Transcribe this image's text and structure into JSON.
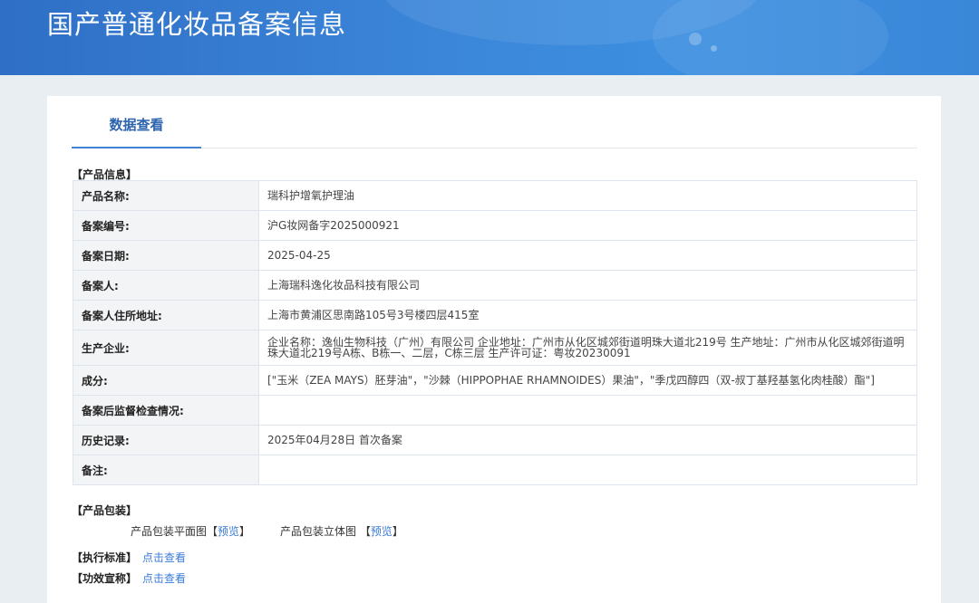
{
  "banner": {
    "title": "国产普通化妆品备案信息"
  },
  "tabs": [
    {
      "label": "数据查看"
    }
  ],
  "product_info": {
    "section_title": "【产品信息】",
    "rows": [
      {
        "label": "产品名称:",
        "value": "瑞科护增氧护理油"
      },
      {
        "label": "备案编号:",
        "value": "沪G妆网备字2025000921"
      },
      {
        "label": "备案日期:",
        "value": "2025-04-25"
      },
      {
        "label": "备案人:",
        "value": "上海瑞科逸化妆品科技有限公司"
      },
      {
        "label": "备案人住所地址:",
        "value": "上海市黄浦区思南路105号3号楼四层415室"
      },
      {
        "label": "生产企业:",
        "value": "企业名称：逸仙生物科技（广州）有限公司 企业地址：广州市从化区城郊街道明珠大道北219号 生产地址：广州市从化区城郊街道明珠大道北219号A栋、B栋一、二层，C栋三层 生产许可证：粤妆20230091"
      },
      {
        "label": "成分:",
        "value": "[\"玉米（ZEA MAYS）胚芽油\"，\"沙棘（HIPPOPHAE RHAMNOIDES）果油\"，\"季戊四醇四（双-叔丁基羟基氢化肉桂酸）酯\"]"
      },
      {
        "label": "备案后监督检查情况:",
        "value": ""
      },
      {
        "label": "历史记录:",
        "value": "2025年04月28日 首次备案"
      },
      {
        "label": "备注:",
        "value": ""
      }
    ]
  },
  "packaging": {
    "section_title": "【产品包装】",
    "flat_label": "产品包装平面图【",
    "flat_link": "预览",
    "flat_close": "】",
    "solid_label": "产品包装立体图 【",
    "solid_link": "预览",
    "solid_close": "】"
  },
  "standard": {
    "label": "【执行标准】",
    "link": "点击查看"
  },
  "efficacy": {
    "label": "【功效宣称】",
    "link": "点击查看"
  }
}
